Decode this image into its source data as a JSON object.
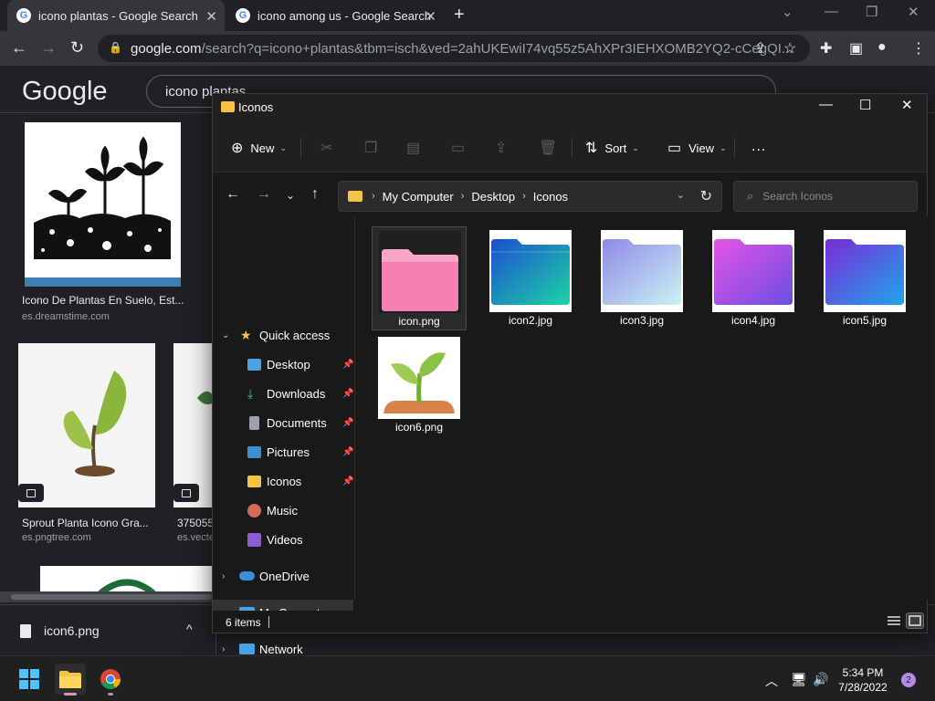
{
  "browser": {
    "tabs": [
      {
        "title": "icono plantas - Google Search",
        "favicon": "G"
      },
      {
        "title": "icono among us - Google Search",
        "favicon": "G"
      }
    ],
    "url_domain": "google.com",
    "url_path": "/search?q=icono+plantas&tbm=isch&ved=2ahUKEwiI74vq55z5AhXPr3IEHXOMB2YQ2-cCegQI..."
  },
  "google": {
    "logo": "Google",
    "query": "icono plantas",
    "results": [
      {
        "title": "Icono De Plantas En Suelo, Est...",
        "source": "es.dreamstime.com"
      },
      {
        "title": "Sprout Planta Icono Gra...",
        "source": "es.pngtree.com"
      },
      {
        "title": "375055...",
        "source": "es.vecte..."
      }
    ]
  },
  "downloads": {
    "file": "icon6.png",
    "caret": "^"
  },
  "explorer": {
    "title": "Iconos",
    "commands": {
      "new": "New",
      "sort": "Sort",
      "view": "View",
      "more": "..."
    },
    "breadcrumb": [
      "My Computer",
      "Desktop",
      "Iconos"
    ],
    "search_placeholder": "Search Iconos",
    "nav": {
      "quick_access": "Quick access",
      "items": [
        {
          "label": "Desktop",
          "icon": "desktop-icon",
          "pinned": true
        },
        {
          "label": "Downloads",
          "icon": "downloads-icon",
          "pinned": true
        },
        {
          "label": "Documents",
          "icon": "documents-icon",
          "pinned": true
        },
        {
          "label": "Pictures",
          "icon": "pictures-icon",
          "pinned": true
        },
        {
          "label": "Iconos",
          "icon": "folder-icon",
          "pinned": true
        },
        {
          "label": "Music",
          "icon": "music-icon",
          "pinned": false
        },
        {
          "label": "Videos",
          "icon": "videos-icon",
          "pinned": false
        }
      ],
      "onedrive": "OneDrive",
      "mycomputer": "My Computer",
      "network": "Network"
    },
    "files": [
      {
        "name": "icon.png",
        "kind": "pink-folder"
      },
      {
        "name": "icon2.jpg",
        "kind": "blue-teal-folder"
      },
      {
        "name": "icon3.jpg",
        "kind": "lavender-folder"
      },
      {
        "name": "icon4.jpg",
        "kind": "magenta-folder"
      },
      {
        "name": "icon5.jpg",
        "kind": "violet-blue-folder"
      },
      {
        "name": "icon6.png",
        "kind": "sprout"
      }
    ],
    "status": "6 items"
  },
  "taskbar": {
    "time": "5:34 PM",
    "date": "7/28/2022",
    "notifications": "2"
  },
  "colors": {
    "accent_folder": "#f6c344",
    "pink_folder": "#f47fb0",
    "sprout_green": "#8bc34a"
  }
}
